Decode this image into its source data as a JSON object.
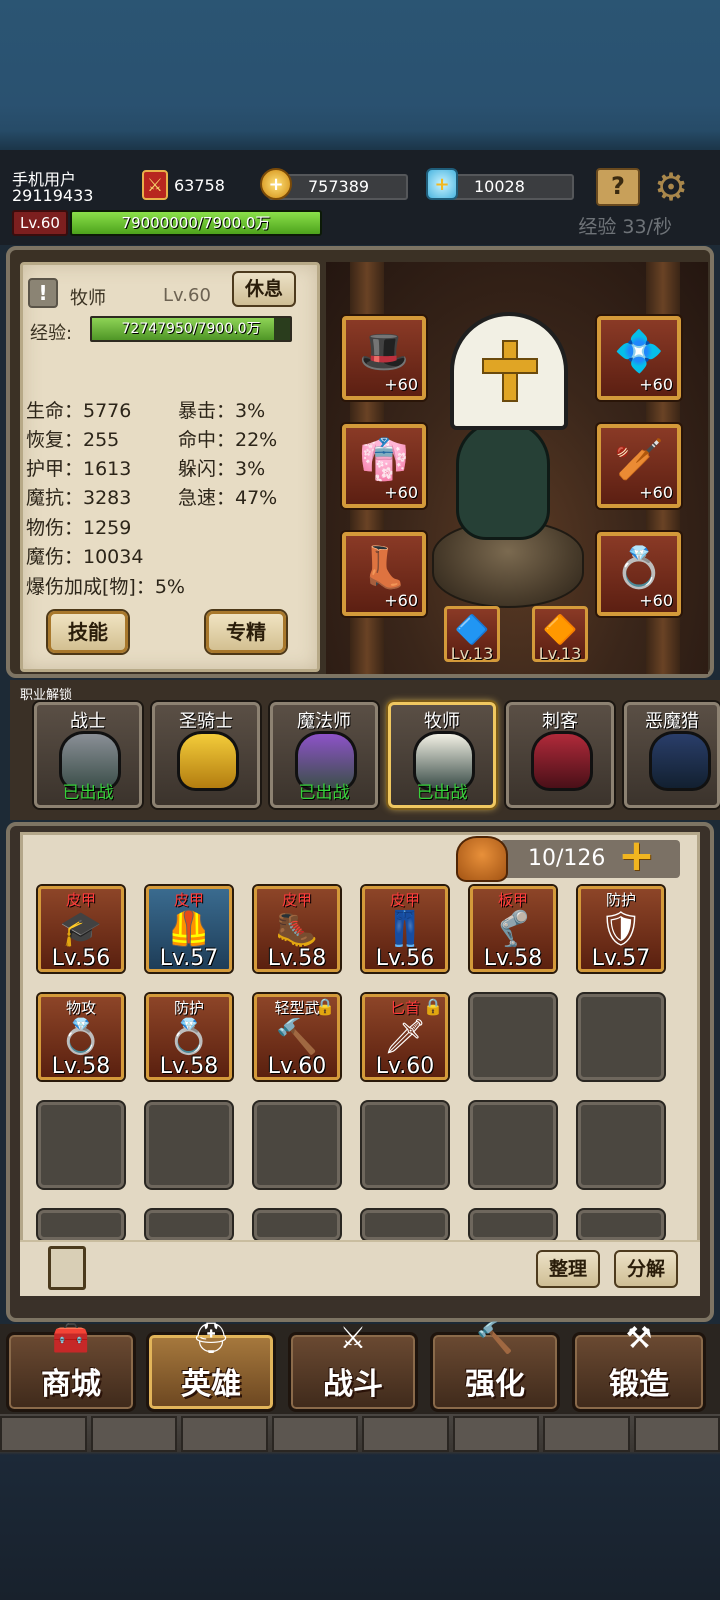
{
  "user": {
    "name": "手机用户",
    "id": "29119433",
    "level": "Lv.60",
    "xp_text": "79000000/7900.0万",
    "xp_fraction": 1.0,
    "rate": "经验 33/秒"
  },
  "resources": {
    "power": "63758",
    "gold": "757389",
    "diamond": "10028"
  },
  "hero": {
    "class_name": "牧师",
    "level": "Lv.60",
    "rest_label": "休息",
    "exp_label": "经验:",
    "exp_text": "72747950/7900.0万",
    "exp_fraction": 0.921,
    "stats_left": [
      "生命：5776",
      "恢复：255",
      "护甲：1613",
      "魔抗：3283",
      "物伤：1259",
      "魔伤：10034",
      "爆伤加成[物]：5%"
    ],
    "stats_right": [
      "暴击：3%",
      "命中：22%",
      "躲闪：3%",
      "急速：47%"
    ],
    "skill_label": "技能",
    "spec_label": "专精"
  },
  "equipment": {
    "plus": "+60",
    "runes": [
      "Lv.13",
      "Lv.13"
    ]
  },
  "class_unlock": {
    "title": "职业解锁",
    "classes": [
      {
        "name": "战士",
        "status": "已出战"
      },
      {
        "name": "圣骑士",
        "status": ""
      },
      {
        "name": "魔法师",
        "status": "已出战"
      },
      {
        "name": "牧师",
        "status": "已出战"
      },
      {
        "name": "刺客",
        "status": ""
      },
      {
        "name": "恶魔猎",
        "status": ""
      }
    ]
  },
  "inventory": {
    "count": "10/126",
    "items": [
      {
        "cat": "皮甲",
        "lv": "Lv.56"
      },
      {
        "cat": "皮甲",
        "lv": "Lv.57"
      },
      {
        "cat": "皮甲",
        "lv": "Lv.58"
      },
      {
        "cat": "皮甲",
        "lv": "Lv.56"
      },
      {
        "cat": "板甲",
        "lv": "Lv.58"
      },
      {
        "cat": "防护",
        "lv": "Lv.57"
      },
      {
        "cat": "物攻",
        "lv": "Lv.58"
      },
      {
        "cat": "防护",
        "lv": "Lv.58"
      },
      {
        "cat": "轻型武",
        "lv": "Lv.60"
      },
      {
        "cat": "匕首",
        "lv": "Lv.60"
      }
    ],
    "sort_label": "整理",
    "decompose_label": "分解"
  },
  "nav": [
    "商城",
    "英雄",
    "战斗",
    "强化",
    "锻造"
  ],
  "colors": {
    "accent_gold": "#d49a3a",
    "xp_green": "#4da31c",
    "status_green": "#37d23a",
    "rare_red": "#ff3b3b"
  }
}
